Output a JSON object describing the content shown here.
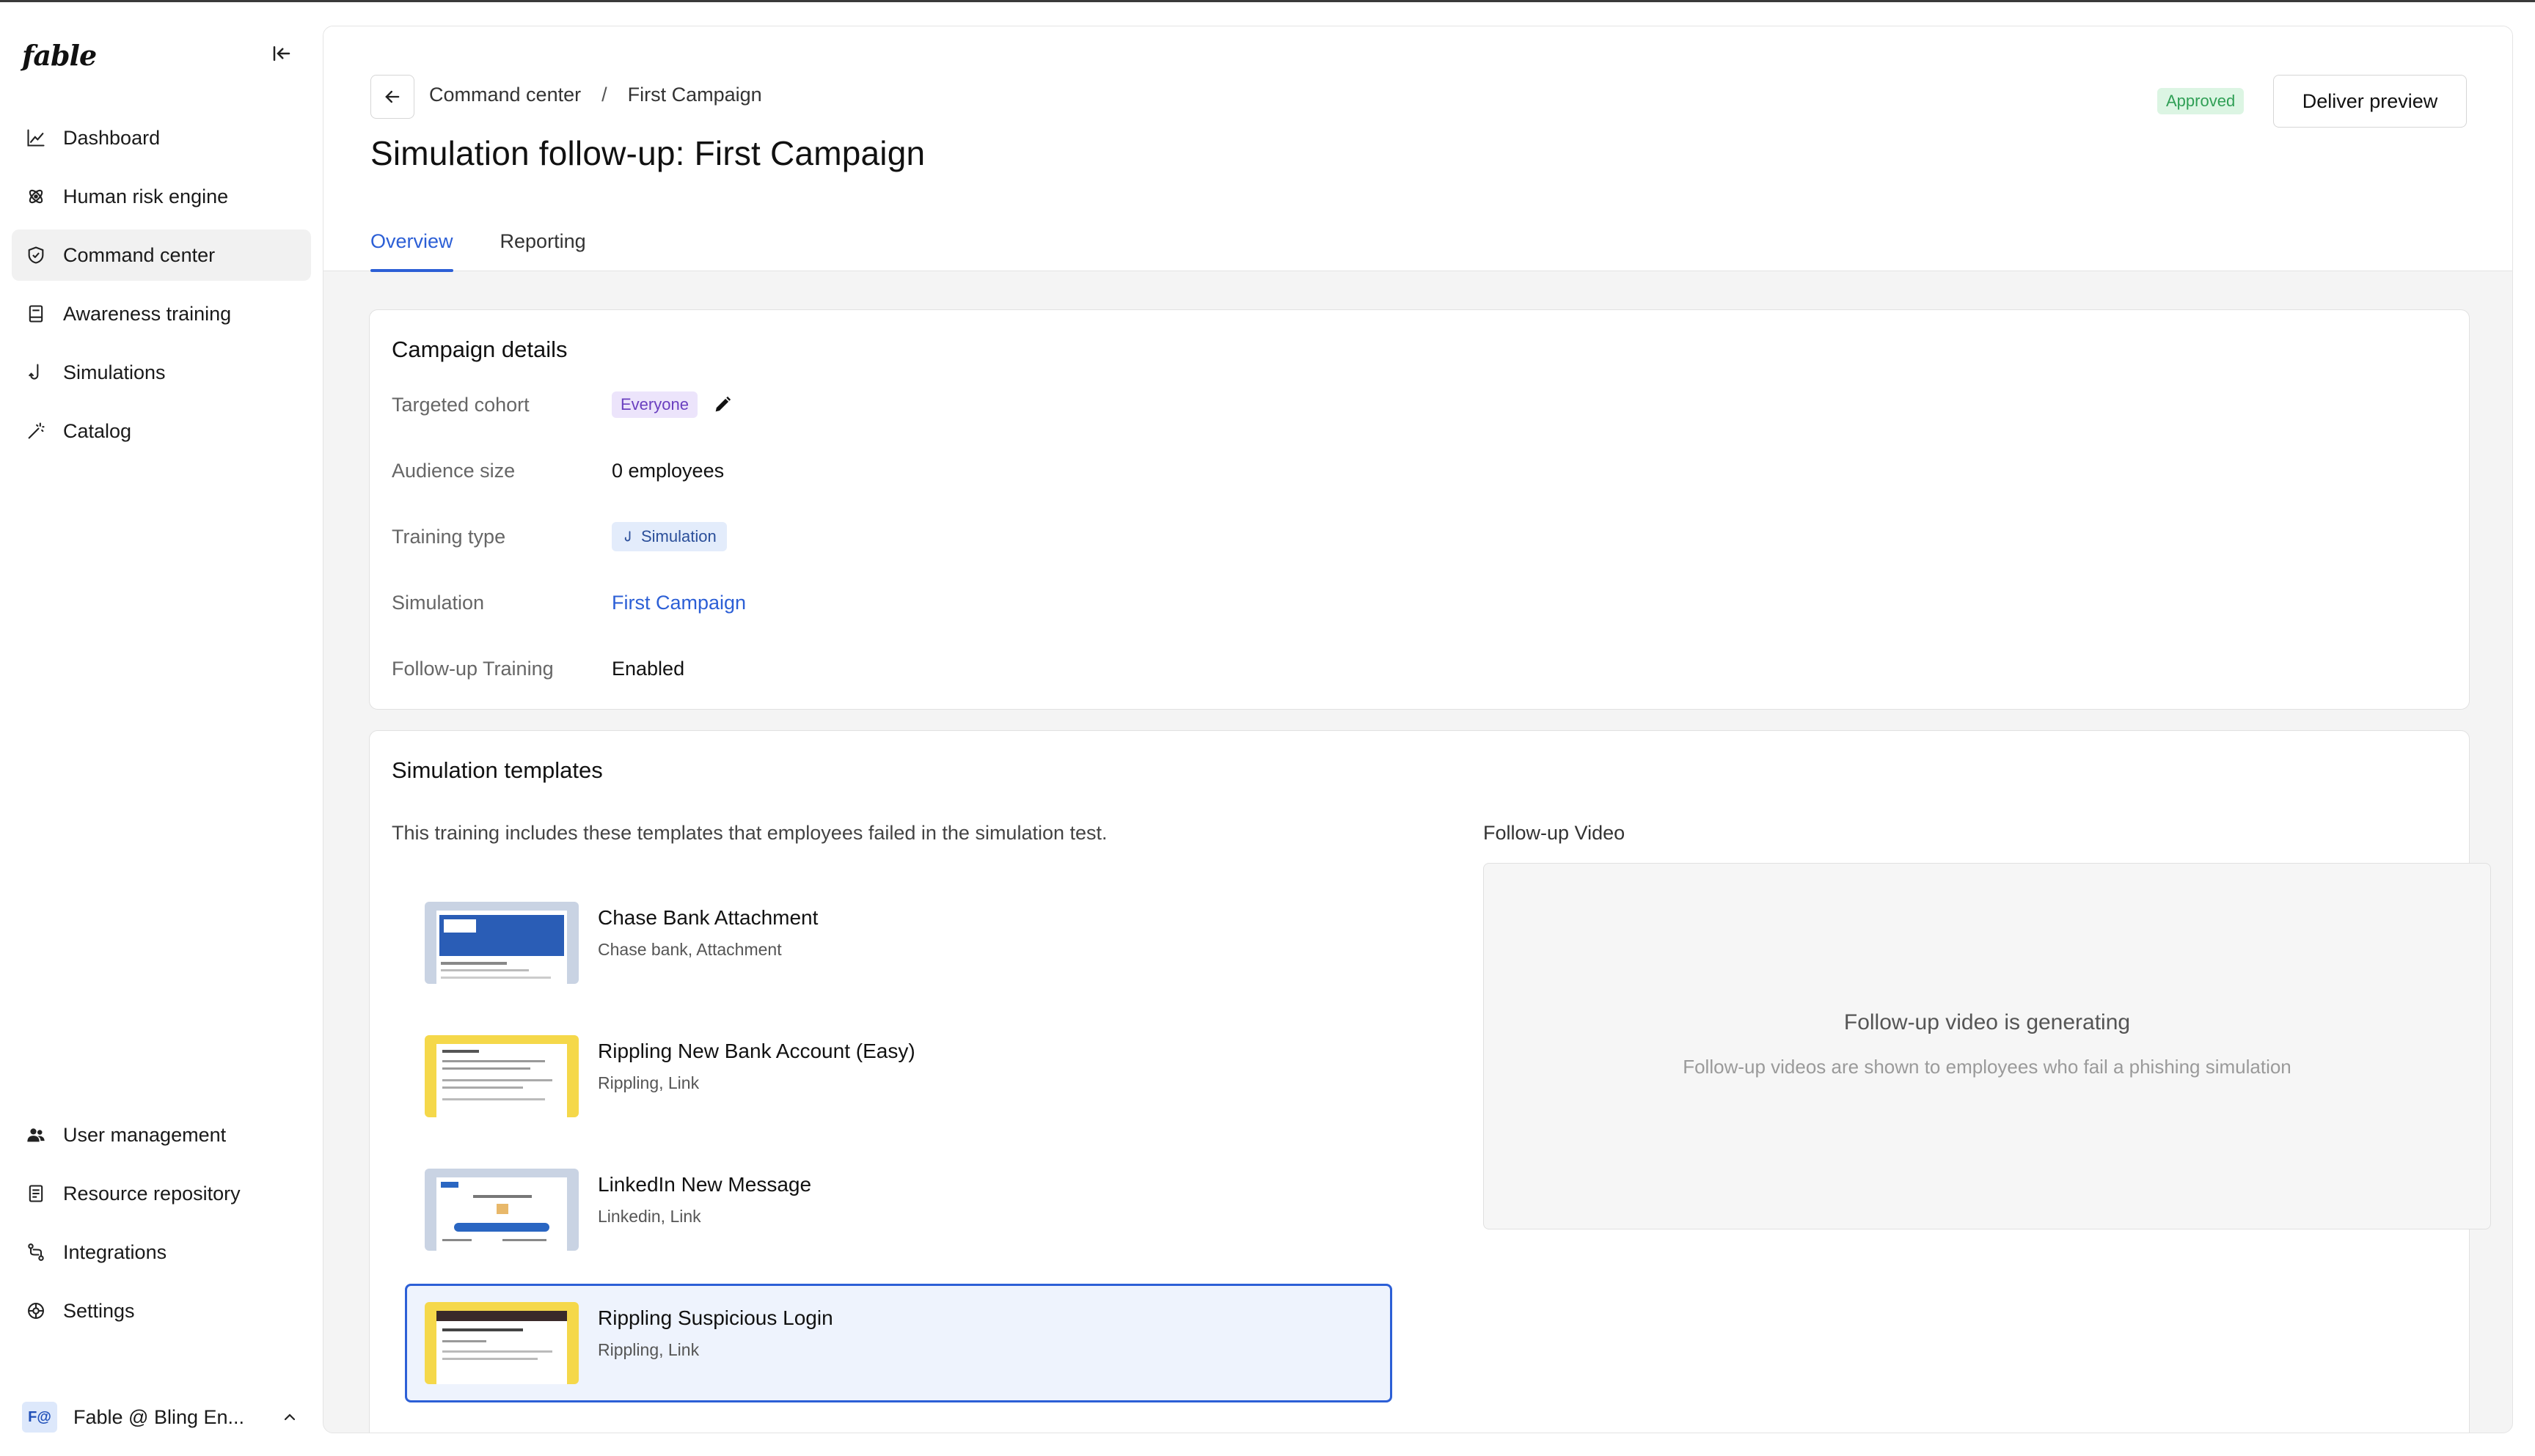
{
  "app": {
    "logo": "fable"
  },
  "sidebar": {
    "items_top": [
      {
        "label": "Dashboard",
        "icon": "chart-line-icon",
        "active": false
      },
      {
        "label": "Human risk engine",
        "icon": "atom-icon",
        "active": false
      },
      {
        "label": "Command center",
        "icon": "shield-check-icon",
        "active": true
      },
      {
        "label": "Awareness training",
        "icon": "book-icon",
        "active": false
      },
      {
        "label": "Simulations",
        "icon": "hook-icon",
        "active": false
      },
      {
        "label": "Catalog",
        "icon": "magic-wand-icon",
        "active": false
      }
    ],
    "items_bottom": [
      {
        "label": "User management",
        "icon": "users-icon"
      },
      {
        "label": "Resource repository",
        "icon": "document-icon"
      },
      {
        "label": "Integrations",
        "icon": "git-branch-icon"
      },
      {
        "label": "Settings",
        "icon": "gear-icon"
      }
    ],
    "account": {
      "avatar": "F@",
      "name": "Fable @ Bling En..."
    }
  },
  "header": {
    "breadcrumb": [
      "Command center",
      "First Campaign"
    ],
    "breadcrumb_sep": "/",
    "title": "Simulation follow-up: First Campaign",
    "status": "Approved",
    "deliver_label": "Deliver preview",
    "tabs": [
      {
        "label": "Overview",
        "active": true
      },
      {
        "label": "Reporting",
        "active": false
      }
    ]
  },
  "campaign_details": {
    "title": "Campaign details",
    "rows": [
      {
        "label": "Targeted cohort",
        "value": "Everyone"
      },
      {
        "label": "Audience size",
        "value": "0 employees"
      },
      {
        "label": "Training type",
        "value": "Simulation"
      },
      {
        "label": "Simulation",
        "value": "First Campaign"
      },
      {
        "label": "Follow-up Training",
        "value": "Enabled"
      }
    ]
  },
  "templates": {
    "title": "Simulation templates",
    "description": "This training includes these templates that employees failed in the simulation test.",
    "items": [
      {
        "name": "Chase Bank Attachment",
        "tags": "Chase bank, Attachment",
        "selected": false
      },
      {
        "name": "Rippling New Bank Account (Easy)",
        "tags": "Rippling, Link",
        "selected": false
      },
      {
        "name": "LinkedIn New Message",
        "tags": "Linkedin, Link",
        "selected": false
      },
      {
        "name": "Rippling Suspicious Login",
        "tags": "Rippling, Link",
        "selected": true
      }
    ],
    "video": {
      "label": "Follow-up Video",
      "status_title": "Follow-up video is generating",
      "status_sub": "Follow-up videos are shown to employees who fail a phishing simulation"
    }
  },
  "colors": {
    "accent": "#2c5fd6",
    "approved_bg": "#dcf5e3",
    "approved_text": "#2f9f55",
    "cohort_bg": "#ece4fb"
  }
}
